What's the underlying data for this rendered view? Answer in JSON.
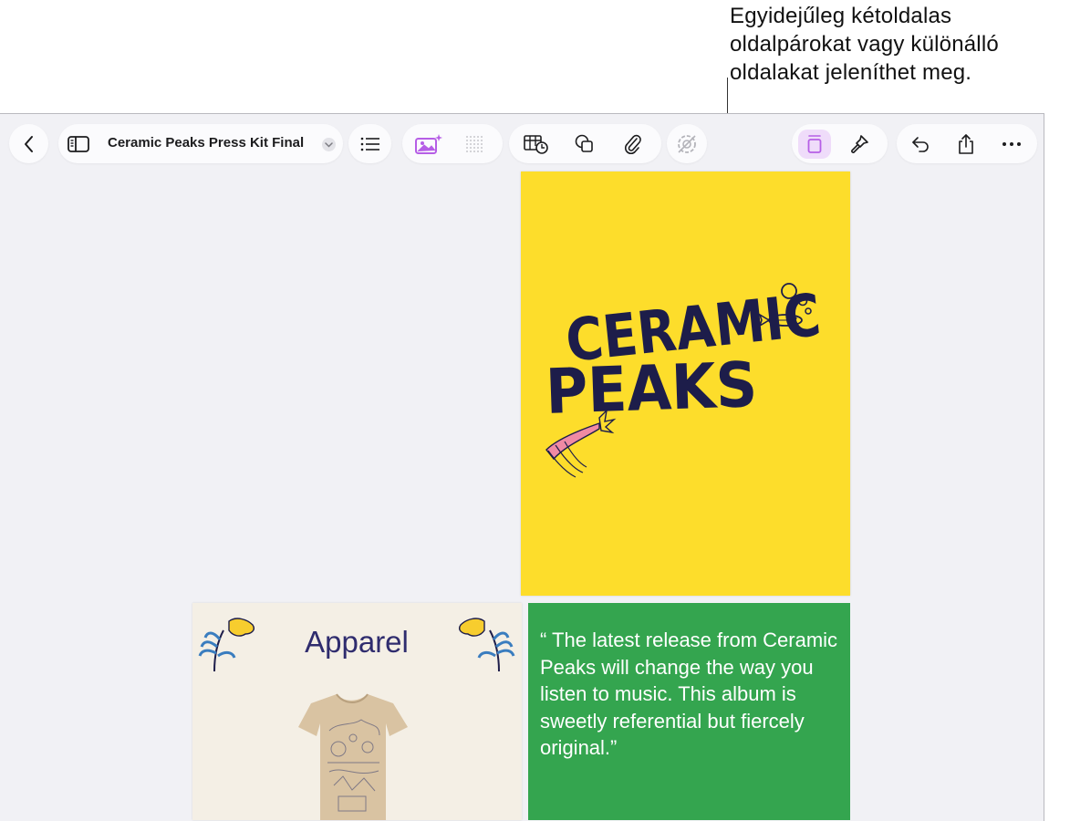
{
  "callout": {
    "line1": "Egyidejűleg kétoldalas",
    "line2": "oldalpárokat vagy különálló",
    "line3": "oldalakat jeleníthet meg."
  },
  "toolbar": {
    "document_title": "Ceramic Peaks Press Kit Final",
    "accent_color": "#b65ee6"
  },
  "pages": {
    "cover": {
      "logo_line1": "CERAMIC",
      "logo_line2": "PEAKS",
      "background": "#fddd2b"
    },
    "apparel": {
      "title": "Apparel"
    },
    "quote": {
      "text": "“ The latest release from Ceramic Peaks will change the way you listen to music. This album is sweetly referential but fiercely original.”"
    }
  }
}
